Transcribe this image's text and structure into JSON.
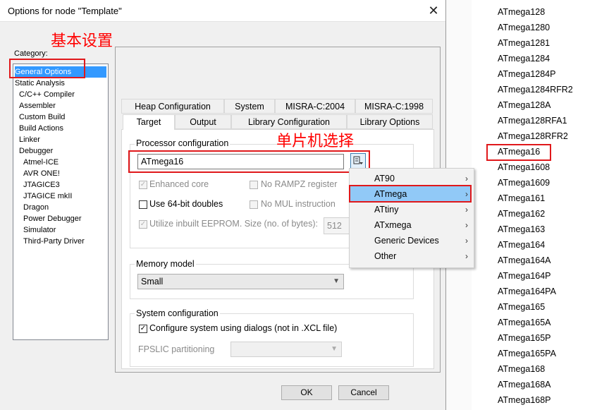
{
  "dialog": {
    "title": "Options for node \"Template\"",
    "close": "✕",
    "category_label": "Category:",
    "categories": [
      {
        "label": "General Options",
        "selected": true
      },
      {
        "label": "Static Analysis"
      },
      {
        "label": "C/C++ Compiler"
      },
      {
        "label": "Assembler"
      },
      {
        "label": "Custom Build"
      },
      {
        "label": "Build Actions"
      },
      {
        "label": "Linker"
      },
      {
        "label": "Debugger"
      },
      {
        "label": "Atmel-ICE"
      },
      {
        "label": "AVR ONE!"
      },
      {
        "label": "JTAGICE3"
      },
      {
        "label": "JTAGICE mkII"
      },
      {
        "label": "Dragon"
      },
      {
        "label": "Power Debugger"
      },
      {
        "label": "Simulator"
      },
      {
        "label": "Third-Party Driver"
      }
    ],
    "tabs_row1": [
      "Heap Configuration",
      "System",
      "MISRA-C:2004",
      "MISRA-C:1998"
    ],
    "tabs_row2": [
      "Target",
      "Output",
      "Library Configuration",
      "Library Options"
    ],
    "processor": {
      "group_title": "Processor configuration",
      "value": "ATmega16",
      "enhanced_core": "Enhanced core",
      "no_rampz": "No RAMPZ register",
      "use64": "Use 64-bit doubles",
      "no_mul": "No MUL instruction",
      "eeprom": "Utilize inbuilt EEPROM. Size (no. of bytes):",
      "eeprom_size": "512"
    },
    "memory": {
      "group_title": "Memory model",
      "value": "Small"
    },
    "system": {
      "group_title": "System configuration",
      "configure": "Configure system using dialogs (not in .XCL file)",
      "fpslic": "FPSLIC partitioning"
    },
    "ok": "OK",
    "cancel": "Cancel"
  },
  "annotations": {
    "basic_settings": "基本设置",
    "mcu_select": "单片机选择"
  },
  "popup_menu": [
    {
      "label": "AT90"
    },
    {
      "label": "ATmega",
      "highlighted": true
    },
    {
      "label": "ATtiny"
    },
    {
      "label": "ATxmega"
    },
    {
      "label": "Generic Devices"
    },
    {
      "label": "Other"
    }
  ],
  "device_list": [
    "ATmega128",
    "ATmega1280",
    "ATmega1281",
    "ATmega1284",
    "ATmega1284P",
    "ATmega1284RFR2",
    "ATmega128A",
    "ATmega128RFA1",
    "ATmega128RFR2",
    "ATmega16",
    "ATmega1608",
    "ATmega1609",
    "ATmega161",
    "ATmega162",
    "ATmega163",
    "ATmega164",
    "ATmega164A",
    "ATmega164P",
    "ATmega164PA",
    "ATmega165",
    "ATmega165A",
    "ATmega165P",
    "ATmega165PA",
    "ATmega168",
    "ATmega168A",
    "ATmega168P"
  ],
  "colors": {
    "highlight_box": "#e0181b",
    "selection": "#3399ff",
    "menu_highlight": "#91c9f7"
  }
}
